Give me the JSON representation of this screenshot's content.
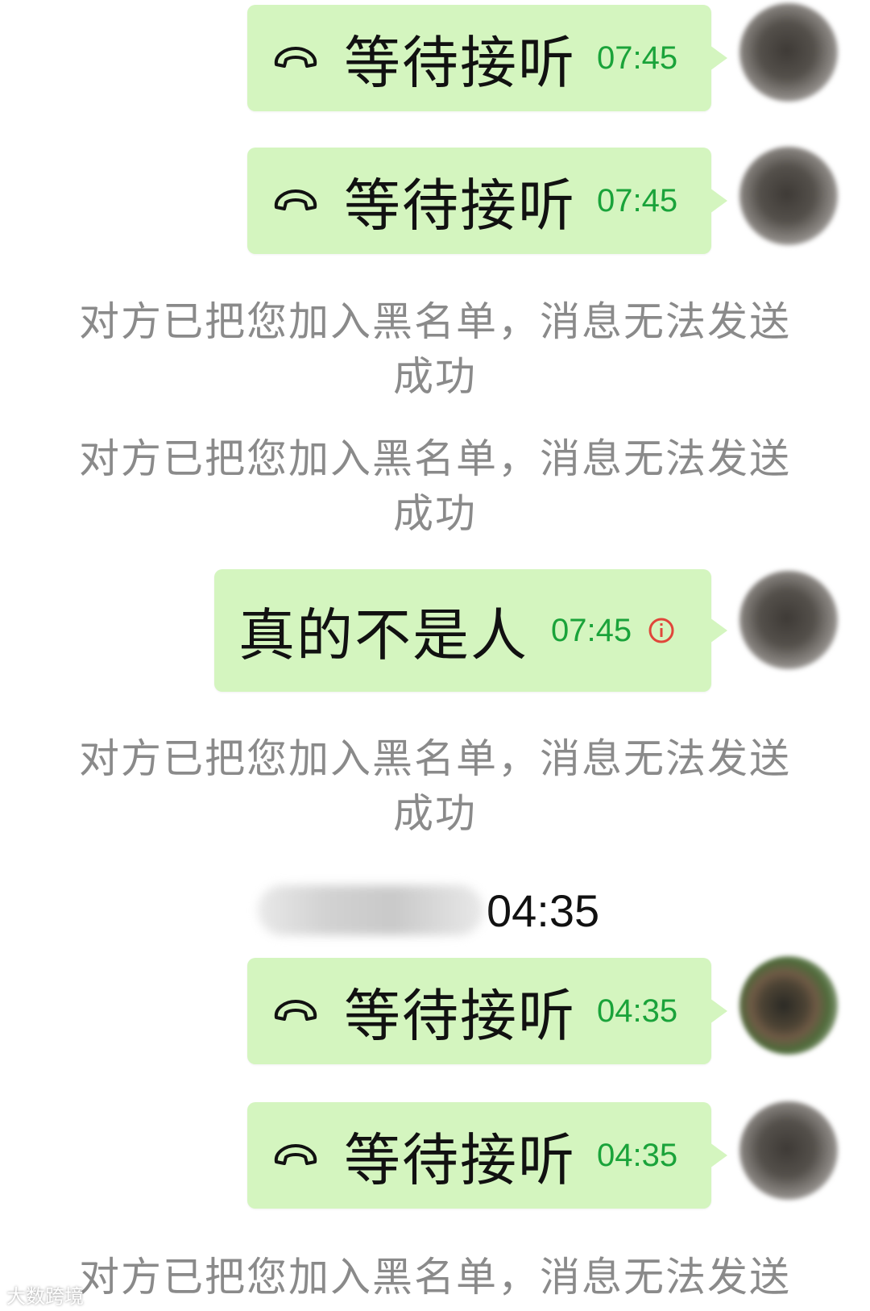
{
  "calls": [
    {
      "label": "等待接听",
      "time": "07:45"
    },
    {
      "label": "等待接听",
      "time": "07:45"
    },
    {
      "label": "等待接听",
      "time": "04:35"
    },
    {
      "label": "等待接听",
      "time": "04:35"
    }
  ],
  "system_notice": {
    "line1": "对方已把您加入黑名单，消息无法发送",
    "line2": "成功"
  },
  "message": {
    "text": "真的不是人",
    "time": "07:45",
    "status_icon": "info-circle-icon"
  },
  "date_divider": {
    "time": "04:35"
  },
  "watermark": "大数跨境",
  "colors": {
    "bubble": "#d4f5bf",
    "time_text": "#1aa33a",
    "system_text": "#8a8a8a",
    "warning": "#e0463a"
  }
}
